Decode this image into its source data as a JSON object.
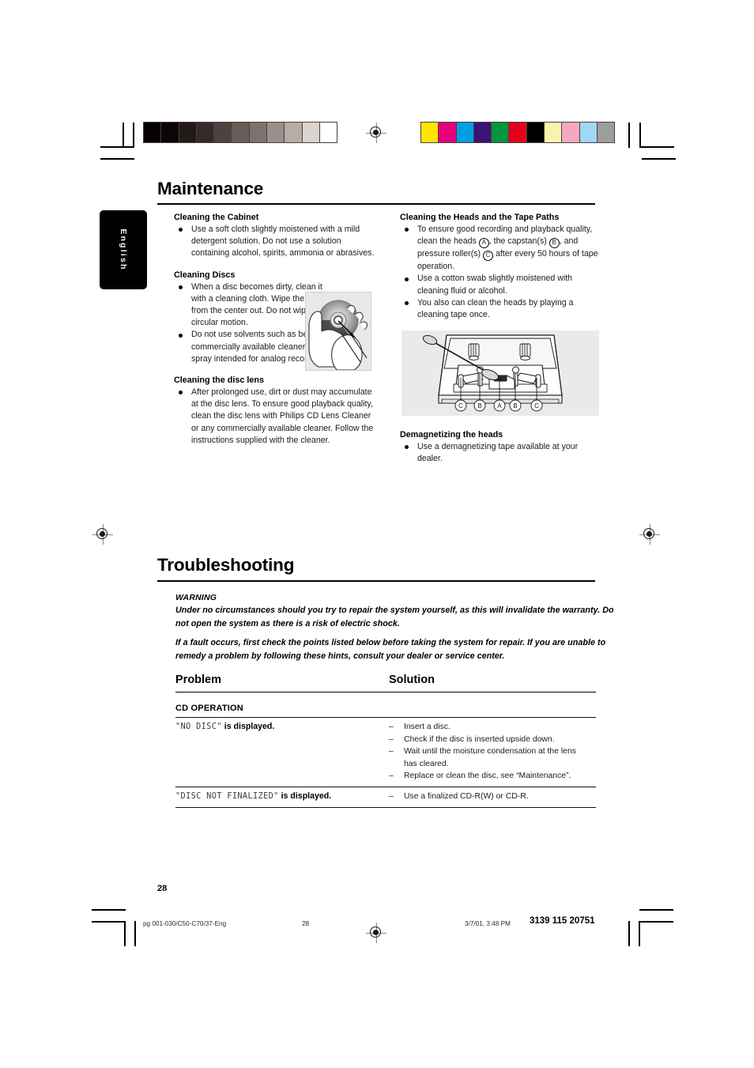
{
  "document": {
    "page_number": "28",
    "language_tab": "English"
  },
  "color_bars": {
    "grayscale": [
      "#050001",
      "#0d0607",
      "#201a19",
      "#342b28",
      "#4c4240",
      "#665c58",
      "#7e726e",
      "#9a8f8b",
      "#b8aca7",
      "#dcd5cf",
      "#ffffff"
    ],
    "process": [
      "#ffe600",
      "#e5007e",
      "#009fe3",
      "#3a1278",
      "#00963f",
      "#e2001a",
      "#000000",
      "#fbf3ad",
      "#f6a8c0",
      "#9ed8f5",
      "#9d9d9c"
    ]
  },
  "maintenance": {
    "title": "Maintenance",
    "left_column": [
      {
        "heading": "Cleaning the Cabinet",
        "bullets": [
          "Use a soft cloth slightly moistened with a mild detergent solution. Do not use a solution containing alcohol, spirits, ammonia or abrasives."
        ]
      },
      {
        "heading": "Cleaning Discs",
        "bullets": [
          "When a disc becomes dirty, clean it with a cleaning cloth. Wipe the disc from the center out.  Do not wipe in a circular motion.",
          "Do not use solvents such as benzine, thinner, commercially available cleaners, or antistatic spray intended for analog records."
        ]
      },
      {
        "heading": "Cleaning the disc lens",
        "bullets": [
          "After prolonged use, dirt or dust may accumulate at the disc lens. To ensure good playback quality, clean the disc lens with Philips CD Lens Cleaner or any commercially available cleaner. Follow the instructions supplied with the cleaner."
        ]
      }
    ],
    "right_column": [
      {
        "heading": "Cleaning the Heads and the Tape Paths",
        "bullets": [
          "To ensure good recording and playback quality, clean the heads (A), the capstan(s) (B), and pressure roller(s) (C) after every 50 hours of tape operation.",
          "Use a cotton swab slightly moistened with cleaning fluid or alcohol.",
          "You also can clean the heads by playing a cleaning tape once."
        ]
      },
      {
        "heading": "Demagnetizing the heads",
        "bullets": [
          "Use a demagnetizing tape available at your dealer."
        ]
      }
    ],
    "figures": {
      "disc_cleaning_caption": "hand wiping disc from center outwards",
      "tape_deck_labels": [
        "C",
        "B",
        "A",
        "B",
        "C"
      ]
    }
  },
  "troubleshooting": {
    "title": "Troubleshooting",
    "warning_label": "WARNING",
    "warning_paragraph_1": "Under no circumstances should you try to repair the system yourself, as this will invalidate the warranty.  Do not open the system as there is a risk of electric shock.",
    "warning_paragraph_2": "If a fault occurs, first check the points listed below before taking the system for repair. If you are unable to remedy a problem by following these hints, consult your dealer or service center.",
    "table": {
      "headers": [
        "Problem",
        "Solution"
      ],
      "group_label": "CD OPERATION",
      "rows": [
        {
          "problem_lcd": "\"NO DISC\"",
          "problem_tail": " is displayed.",
          "solutions": [
            "Insert a disc.",
            "Check if the disc is inserted upside down.",
            "Wait until the moisture condensation at the lens",
            "has cleared.",
            "Replace or clean the disc, see “Maintenance”."
          ],
          "solution_continuations": [
            false,
            false,
            false,
            true,
            false
          ]
        },
        {
          "problem_lcd": "\"DISC NOT FINALIZED\"",
          "problem_tail": " is displayed.",
          "solutions": [
            "Use a finalized CD-R(W) or CD-R."
          ],
          "solution_continuations": [
            false
          ]
        }
      ]
    }
  },
  "footer": {
    "file_ref": "pg 001-030/C50-C70/37-Eng",
    "page": "28",
    "timestamp": "3/7/01, 3:48 PM",
    "doc_code": "3139 115 20751"
  }
}
